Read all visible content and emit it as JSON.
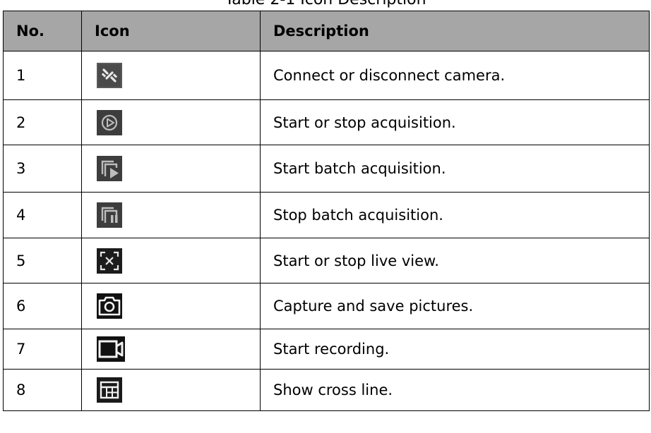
{
  "caption": "Table 2-1 Icon Description",
  "table": {
    "headers": [
      "No.",
      "Icon",
      "Description"
    ],
    "rows": [
      {
        "no": "1",
        "icon": "connect-disconnect-camera-icon",
        "description": "Connect or disconnect camera."
      },
      {
        "no": "2",
        "icon": "play-circle-icon",
        "description": "Start or stop acquisition."
      },
      {
        "no": "3",
        "icon": "batch-play-icon",
        "description": "Start batch acquisition."
      },
      {
        "no": "4",
        "icon": "batch-pause-icon",
        "description": "Stop batch acquisition."
      },
      {
        "no": "5",
        "icon": "live-view-focus-icon",
        "description": "Start or stop live view."
      },
      {
        "no": "6",
        "icon": "camera-capture-icon",
        "description": "Capture and save pictures."
      },
      {
        "no": "7",
        "icon": "video-record-icon",
        "description": "Start recording."
      },
      {
        "no": "8",
        "icon": "cross-line-grid-icon",
        "description": "Show cross line."
      }
    ]
  },
  "colors": {
    "header_background": "#a6a6a6",
    "icon_background_gray": "#3a3a3a",
    "icon_background_black": "#111111"
  }
}
